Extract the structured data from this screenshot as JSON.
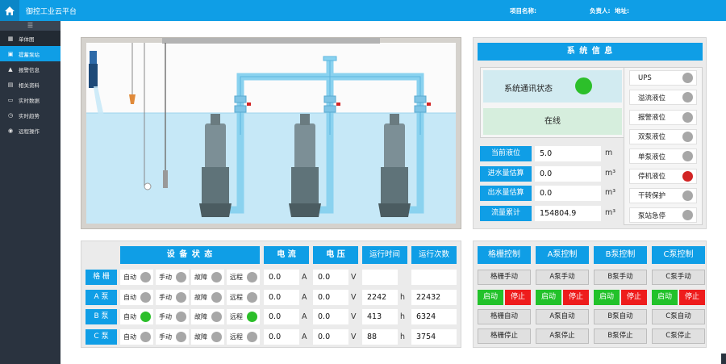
{
  "app": {
    "title": "御控工业云平台",
    "project_label": "项目名称:",
    "owner_label": "负责人:",
    "address_label": "地址:"
  },
  "sidebar": {
    "toggle": "☰",
    "items": [
      {
        "label": "单体图",
        "icon": "▦"
      },
      {
        "label": "提蓄泵站",
        "icon": "▣"
      },
      {
        "label": "报警信息",
        "icon": "▲"
      },
      {
        "label": "相关资料",
        "icon": "▤"
      },
      {
        "label": "实时数据",
        "icon": "▭"
      },
      {
        "label": "实时趋势",
        "icon": "◷"
      },
      {
        "label": "远程操作",
        "icon": "◉"
      }
    ]
  },
  "system": {
    "title": "系 统 信 息",
    "comm_label": "系统通讯状态",
    "comm_status": "在线",
    "metrics": [
      {
        "label": "当前液位",
        "value": "5.0",
        "unit": "m"
      },
      {
        "label": "进水量估算",
        "value": "0.0",
        "unit": "m³"
      },
      {
        "label": "出水量估算",
        "value": "0.0",
        "unit": "m³"
      },
      {
        "label": "流量累计",
        "value": "154804.9",
        "unit": "m³"
      }
    ],
    "indicators": [
      {
        "label": "UPS",
        "state": "off"
      },
      {
        "label": "溢流液位",
        "state": "off"
      },
      {
        "label": "报警液位",
        "state": "off"
      },
      {
        "label": "双泵液位",
        "state": "off"
      },
      {
        "label": "单泵液位",
        "state": "off"
      },
      {
        "label": "停机液位",
        "state": "alarm"
      },
      {
        "label": "干转保护",
        "state": "off"
      },
      {
        "label": "泵站急停",
        "state": "off"
      }
    ]
  },
  "status": {
    "header": {
      "device": "设 备 状 态",
      "current": "电 流",
      "voltage": "电 压",
      "runtime": "运行时间",
      "count": "运行次数"
    },
    "units": {
      "current": "A",
      "voltage": "V",
      "runtime": "h"
    },
    "mode_labels": [
      "自动",
      "手动",
      "故障",
      "远程"
    ],
    "rows": [
      {
        "name": "格 栅",
        "modes": [
          "off",
          "off",
          "off",
          "off"
        ],
        "current": "0.0",
        "voltage": "0.0",
        "runtime": "",
        "count": ""
      },
      {
        "name": "A 泵",
        "modes": [
          "off",
          "off",
          "off",
          "off"
        ],
        "current": "0.0",
        "voltage": "0.0",
        "runtime": "2242",
        "count": "22432"
      },
      {
        "name": "B 泵",
        "modes": [
          "on",
          "off",
          "off",
          "on"
        ],
        "current": "0.0",
        "voltage": "0.0",
        "runtime": "413",
        "count": "6324"
      },
      {
        "name": "C 泵",
        "modes": [
          "off",
          "off",
          "off",
          "off"
        ],
        "current": "0.0",
        "voltage": "0.0",
        "runtime": "88",
        "count": "3754"
      }
    ]
  },
  "control": {
    "columns": [
      {
        "header": "格栅控制",
        "manual": "格栅手动",
        "start": "启动",
        "stop": "停止",
        "auto": "格栅自动",
        "halt": "格栅停止"
      },
      {
        "header": "A泵控制",
        "manual": "A泵手动",
        "start": "启动",
        "stop": "停止",
        "auto": "A泵自动",
        "halt": "A泵停止"
      },
      {
        "header": "B泵控制",
        "manual": "B泵手动",
        "start": "启动",
        "stop": "停止",
        "auto": "B泵自动",
        "halt": "B泵停止"
      },
      {
        "header": "C泵控制",
        "manual": "C泵手动",
        "start": "启动",
        "stop": "停止",
        "auto": "C泵自动",
        "halt": "C泵停止"
      }
    ]
  },
  "colors": {
    "accent": "#0f9ee6",
    "on": "#2cbf2a",
    "alarm": "#d22424",
    "off": "#a7a7a7"
  }
}
